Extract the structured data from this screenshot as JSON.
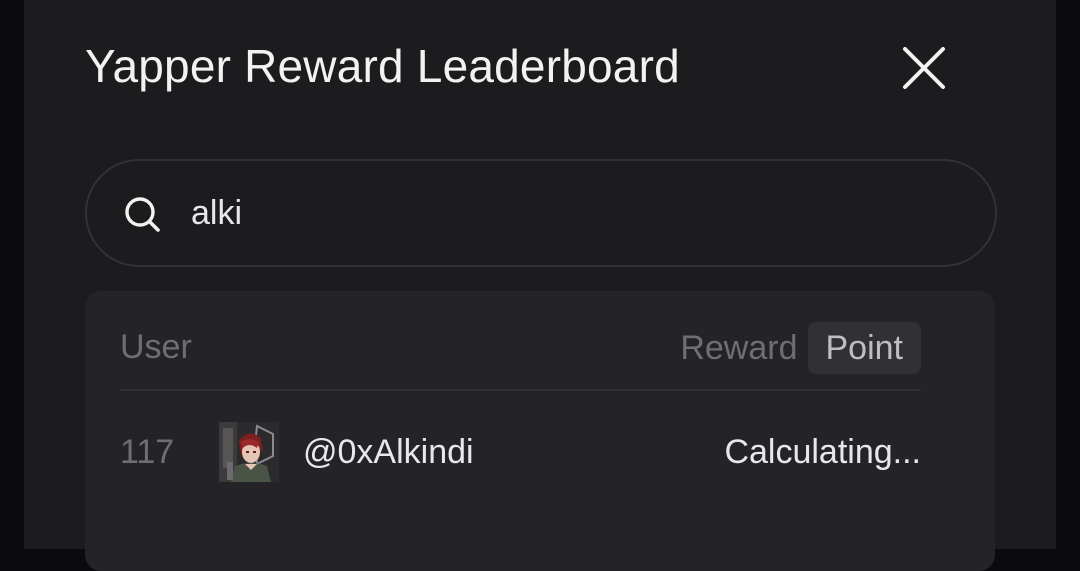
{
  "modal": {
    "title": "Yapper Reward Leaderboard",
    "close_icon": "close-icon"
  },
  "search": {
    "icon": "search-icon",
    "value": "alki",
    "placeholder": ""
  },
  "table": {
    "header_user": "User",
    "tabs": [
      {
        "label": "Reward",
        "selected": false
      },
      {
        "label": "Point",
        "selected": true
      }
    ],
    "rows": [
      {
        "rank": "117",
        "username": "@0xAlkindi",
        "value": "Calculating..."
      }
    ]
  },
  "colors": {
    "modal_bg": "#1c1c1f",
    "panel_bg": "#242428",
    "text_primary": "#e8e8ea",
    "text_muted": "#6e6e74",
    "tab_selected_bg": "#303035"
  }
}
